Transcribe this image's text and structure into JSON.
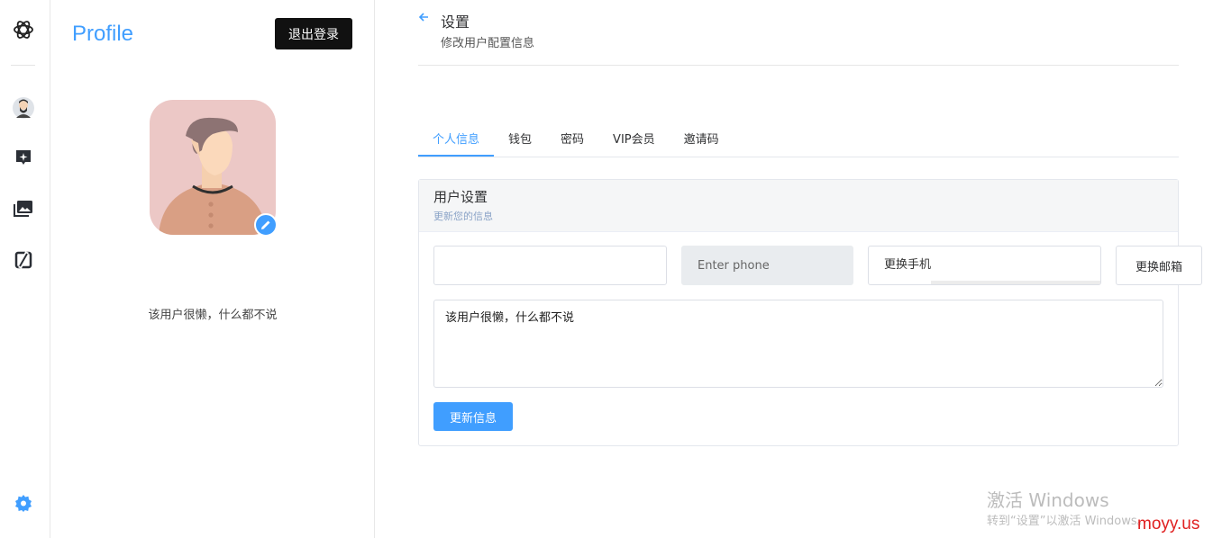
{
  "rail": {
    "icons": [
      "openai-logo-icon",
      "user-avatar-icon",
      "ai-chat-icon",
      "image-gallery-icon",
      "midjourney-icon",
      "settings-gear-icon"
    ]
  },
  "profile": {
    "title": "Profile",
    "logout_label": "退出登录",
    "bio": "该用户很懒，什么都不说"
  },
  "header": {
    "title": "设置",
    "subtitle": "修改用户配置信息"
  },
  "tabs": [
    {
      "label": "个人信息",
      "active": true
    },
    {
      "label": "钱包",
      "active": false
    },
    {
      "label": "密码",
      "active": false
    },
    {
      "label": "VIP会员",
      "active": false
    },
    {
      "label": "邀请码",
      "active": false
    }
  ],
  "card": {
    "title": "用户设置",
    "subtitle": "更新您的信息",
    "name_value": "",
    "phone_placeholder": "Enter phone",
    "change_phone_label": "更换手机",
    "change_email_label": "更换邮箱",
    "bio_value": "该用户很懒，什么都不说",
    "update_label": "更新信息"
  },
  "watermark": {
    "line1": "激活 Windows",
    "line2": "转到“设置”以激活 Windows。",
    "brand": "moyy.us"
  },
  "colors": {
    "accent": "#409eff",
    "logout_bg": "#111111",
    "brand_red": "#e02020"
  }
}
